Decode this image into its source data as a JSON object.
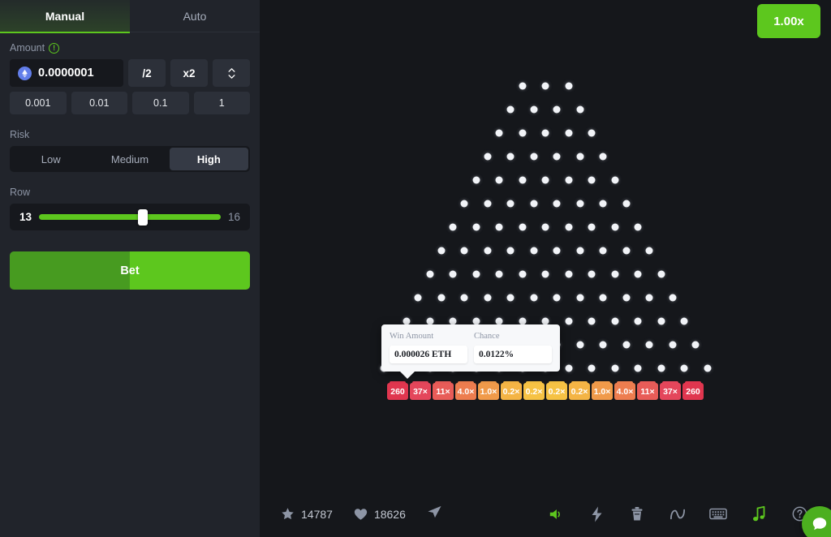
{
  "tabs": [
    {
      "label": "Manual",
      "active": true
    },
    {
      "label": "Auto",
      "active": false
    }
  ],
  "amount": {
    "label": "Amount",
    "info_icon": "info-circle-icon",
    "coin_icon": "ethereum-coin-icon",
    "value": "0.0000001",
    "half_label": "/2",
    "double_label": "x2",
    "stepper_icon": "stepper-up-down-icon",
    "quick": [
      "0.001",
      "0.01",
      "0.1",
      "1"
    ]
  },
  "risk": {
    "label": "Risk",
    "options": [
      "Low",
      "Medium",
      "High"
    ],
    "selected": "High"
  },
  "row": {
    "label": "Row",
    "min": "13",
    "max": "16",
    "value": 13,
    "handle_percent": 57
  },
  "bet": {
    "label": "Bet"
  },
  "board": {
    "multiplier_badge": "1.00x",
    "peg_rows": [
      3,
      4,
      5,
      6,
      7,
      8,
      9,
      10,
      11,
      12,
      13,
      14,
      15
    ],
    "buckets": [
      {
        "label": "260",
        "color": "#e0364f"
      },
      {
        "label": "37×",
        "color": "#e4465b"
      },
      {
        "label": "11×",
        "color": "#e85c58"
      },
      {
        "label": "4.0×",
        "color": "#ed7d4f"
      },
      {
        "label": "1.0×",
        "color": "#f09a4a"
      },
      {
        "label": "0.2×",
        "color": "#f4b445"
      },
      {
        "label": "0.2×",
        "color": "#f6c244"
      },
      {
        "label": "0.2×",
        "color": "#f6c244"
      },
      {
        "label": "0.2×",
        "color": "#f4b445"
      },
      {
        "label": "1.0×",
        "color": "#f09a4a"
      },
      {
        "label": "4.0×",
        "color": "#ed7d4f"
      },
      {
        "label": "11×",
        "color": "#e85c58"
      },
      {
        "label": "37×",
        "color": "#e4465b"
      },
      {
        "label": "260",
        "color": "#e0364f"
      }
    ]
  },
  "tooltip": {
    "win_label": "Win Amount",
    "win_value": "0.000026 ETH",
    "chance_label": "Chance",
    "chance_value": "0.0122%"
  },
  "bottom": {
    "favorites_icon": "star-icon",
    "favorites_count": "14787",
    "likes_icon": "heart-icon",
    "likes_count": "18626",
    "share_icon": "send-icon",
    "tools": [
      {
        "name": "sound-icon",
        "active": true
      },
      {
        "name": "lightning-icon",
        "active": false
      },
      {
        "name": "trash-icon",
        "active": false
      },
      {
        "name": "fairness-icon",
        "active": false
      },
      {
        "name": "keyboard-icon",
        "active": false
      },
      {
        "name": "music-icon",
        "active": true
      },
      {
        "name": "help-icon",
        "active": false
      }
    ],
    "fab_icon": "chat-bubble-icon"
  },
  "colors": {
    "accent": "#5dc71e",
    "sidebar_bg": "#21242b",
    "stage_bg": "#15171b"
  }
}
